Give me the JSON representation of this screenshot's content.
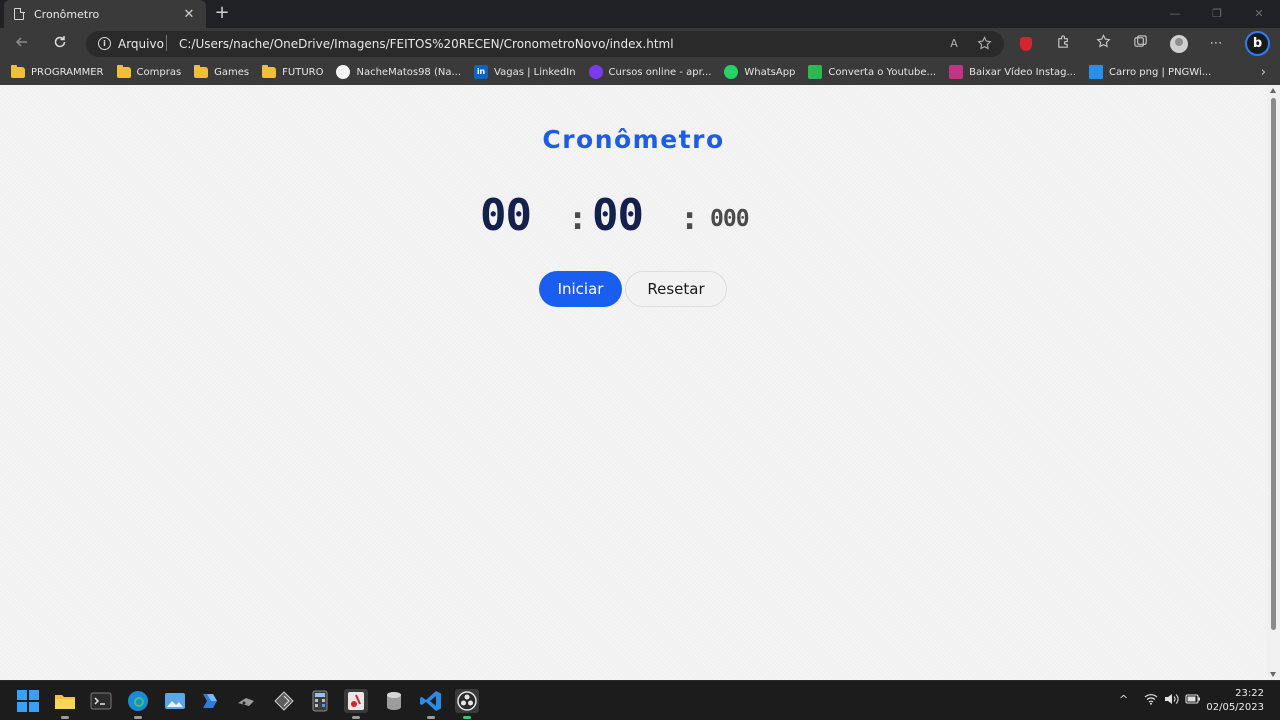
{
  "browser": {
    "tab_title": "Cronômetro",
    "tab_close": "✕",
    "new_tab": "+",
    "window_controls": [
      "—",
      "❐",
      "✕"
    ],
    "address_label": "Arquivo",
    "url": "C:/Users/nache/OneDrive/Imagens/FEITOS%20RECEN/CronometroNovo/index.html",
    "read_aloud_icon": "A",
    "bing_label": "b"
  },
  "bookmarks": [
    {
      "label": "PROGRAMMER",
      "icon": "folder-icon",
      "kind": "folder"
    },
    {
      "label": "Compras",
      "icon": "folder-icon",
      "kind": "folder"
    },
    {
      "label": "Games",
      "icon": "folder-icon",
      "kind": "folder"
    },
    {
      "label": "FUTURO",
      "icon": "folder-icon",
      "kind": "folder"
    },
    {
      "label": "NacheMatos98 (Na...",
      "icon": "github-icon",
      "kind": "github"
    },
    {
      "label": "Vagas | LinkedIn",
      "icon": "linkedin-icon",
      "kind": "linkedin",
      "glyph": "in"
    },
    {
      "label": "Cursos online - apr...",
      "icon": "udemy-icon",
      "kind": "udemy"
    },
    {
      "label": "WhatsApp",
      "icon": "whatsapp-icon",
      "kind": "whatsapp"
    },
    {
      "label": "Converta o Youtube...",
      "icon": "download-icon",
      "kind": "download"
    },
    {
      "label": "Baixar Vídeo Instag...",
      "icon": "instagram-icon",
      "kind": "insta"
    },
    {
      "label": "Carro png | PNGWi...",
      "icon": "pngwing-icon",
      "kind": "png"
    }
  ],
  "app": {
    "title": "Cronômetro",
    "minutes": "00",
    "seconds": "00",
    "milliseconds": "000",
    "separator": ":",
    "start_label": "Iniciar",
    "reset_label": "Resetar",
    "accent_color": "#1a5ef0",
    "digit_color": "#15204d"
  },
  "taskbar": {
    "tray_chevron": "^",
    "time": "23:22",
    "date": "02/05/2023"
  }
}
